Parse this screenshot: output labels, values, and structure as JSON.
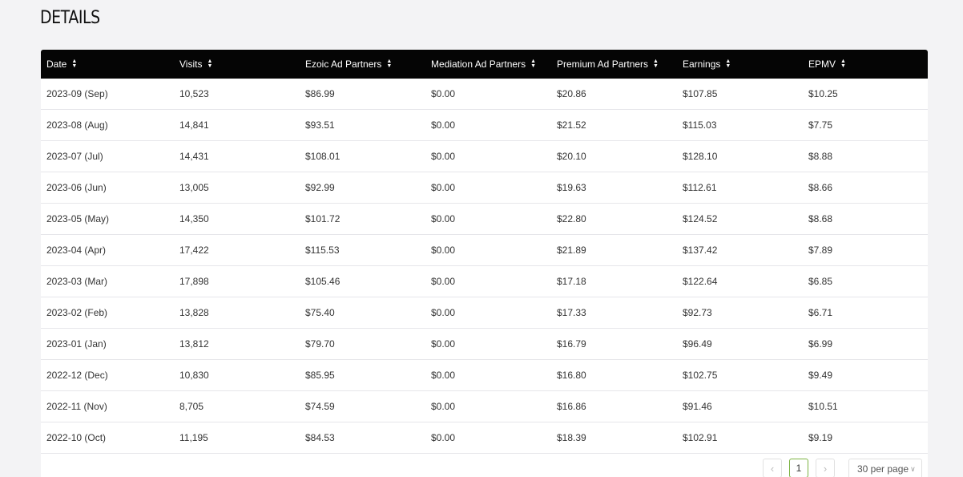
{
  "section": {
    "title": "DETAILS"
  },
  "table": {
    "headers": [
      "Date",
      "Visits",
      "Ezoic Ad Partners",
      "Mediation Ad Partners",
      "Premium Ad Partners",
      "Earnings",
      "EPMV"
    ],
    "rows": [
      [
        "2023-09 (Sep)",
        "10,523",
        "$86.99",
        "$0.00",
        "$20.86",
        "$107.85",
        "$10.25"
      ],
      [
        "2023-08 (Aug)",
        "14,841",
        "$93.51",
        "$0.00",
        "$21.52",
        "$115.03",
        "$7.75"
      ],
      [
        "2023-07 (Jul)",
        "14,431",
        "$108.01",
        "$0.00",
        "$20.10",
        "$128.10",
        "$8.88"
      ],
      [
        "2023-06 (Jun)",
        "13,005",
        "$92.99",
        "$0.00",
        "$19.63",
        "$112.61",
        "$8.66"
      ],
      [
        "2023-05 (May)",
        "14,350",
        "$101.72",
        "$0.00",
        "$22.80",
        "$124.52",
        "$8.68"
      ],
      [
        "2023-04 (Apr)",
        "17,422",
        "$115.53",
        "$0.00",
        "$21.89",
        "$137.42",
        "$7.89"
      ],
      [
        "2023-03 (Mar)",
        "17,898",
        "$105.46",
        "$0.00",
        "$17.18",
        "$122.64",
        "$6.85"
      ],
      [
        "2023-02 (Feb)",
        "13,828",
        "$75.40",
        "$0.00",
        "$17.33",
        "$92.73",
        "$6.71"
      ],
      [
        "2023-01 (Jan)",
        "13,812",
        "$79.70",
        "$0.00",
        "$16.79",
        "$96.49",
        "$6.99"
      ],
      [
        "2022-12 (Dec)",
        "10,830",
        "$85.95",
        "$0.00",
        "$16.80",
        "$102.75",
        "$9.49"
      ],
      [
        "2022-11 (Nov)",
        "8,705",
        "$74.59",
        "$0.00",
        "$16.86",
        "$91.46",
        "$10.51"
      ],
      [
        "2022-10 (Oct)",
        "11,195",
        "$84.53",
        "$0.00",
        "$18.39",
        "$102.91",
        "$9.19"
      ]
    ]
  },
  "pagination": {
    "prev_icon": "chevron-left-icon",
    "next_icon": "chevron-right-icon",
    "current_page": "1",
    "per_page": "30 per page"
  },
  "colors": {
    "header_bg": "#050505",
    "page_bg": "#f3f3f5",
    "accent": "#7cb342"
  }
}
